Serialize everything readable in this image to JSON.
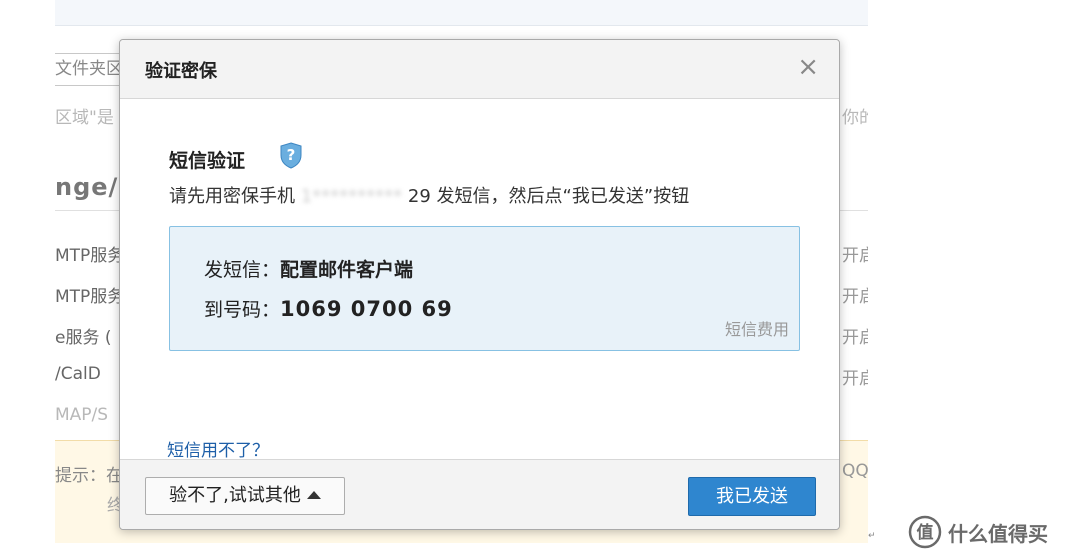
{
  "background": {
    "input_partial": "文件夹区",
    "desc_partial": "区域\"是",
    "desc_right_partial": "你的",
    "heading_partial": "nge/",
    "rows": [
      {
        "left": "MTP服务",
        "right": "开启"
      },
      {
        "left": "MTP服务",
        "right": "开启"
      },
      {
        "left": "e服务 (",
        "right": "开启"
      },
      {
        "left": "/CalD",
        "right": "开启"
      }
    ],
    "row_imap": "MAP/S",
    "tip_partial": "提示：在",
    "tip_line2": "终",
    "tip_right": "QQ"
  },
  "modal": {
    "title": "验证密保",
    "close_glyph": "×",
    "sms_heading": "短信验证",
    "help_icon": "question-shield-icon",
    "instruction_prefix": "请先用密保手机",
    "instruction_masked": "1**********",
    "instruction_suffix": "29 发短信，然后点“我已发送”按钮",
    "send_label": "发短信：",
    "send_content": "配置邮件客户端",
    "to_label": "到号码：",
    "to_number": "1069 0700 69",
    "fee_link": "短信费用",
    "cannot_link": "短信用不了？",
    "other_button": "验不了,试试其他",
    "sent_button": "我已发送"
  },
  "watermark": {
    "text": "什么值得买",
    "icon": "smzdm-logo-icon"
  },
  "colors": {
    "primary_button": "#2f86cf",
    "link": "#1e5fa8",
    "info_box_bg": "#e8f2f9",
    "info_box_border": "#87c1e3"
  }
}
